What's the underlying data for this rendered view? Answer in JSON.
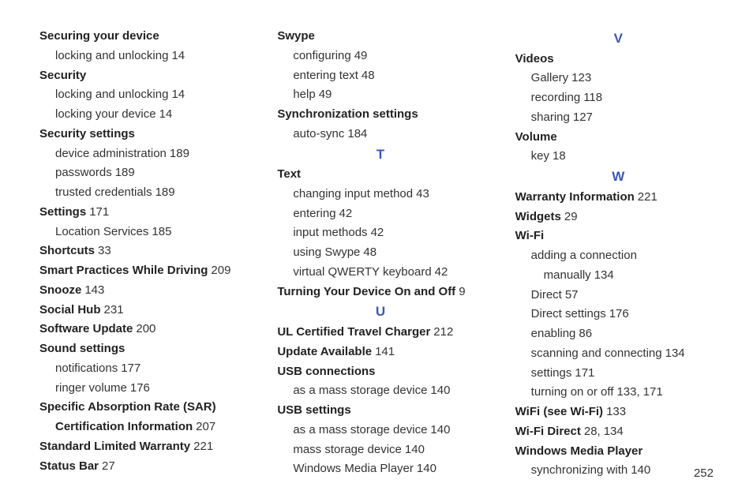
{
  "page_number": "252",
  "col1": {
    "e1_term": "Securing your device",
    "e1_s1": "locking and unlocking",
    "e1_s1_pg": "14",
    "e2_term": "Security",
    "e2_s1": "locking and unlocking",
    "e2_s1_pg": "14",
    "e2_s2": "locking your device",
    "e2_s2_pg": "14",
    "e3_term": "Security settings",
    "e3_s1": "device administration",
    "e3_s1_pg": "189",
    "e3_s2": "passwords",
    "e3_s2_pg": "189",
    "e3_s3": "trusted credentials",
    "e3_s3_pg": "189",
    "e4_term": "Settings",
    "e4_pg": "171",
    "e4_s1": "Location Services",
    "e4_s1_pg": "185",
    "e5_term": "Shortcuts",
    "e5_pg": "33",
    "e6_term": "Smart Practices While Driving",
    "e6_pg": "209",
    "e7_term": "Snooze",
    "e7_pg": "143",
    "e8_term": "Social Hub",
    "e8_pg": "231",
    "e9_term": "Software Update",
    "e9_pg": "200",
    "e10_term": "Sound settings",
    "e10_s1": "notifications",
    "e10_s1_pg": "177",
    "e10_s2": "ringer volume",
    "e10_s2_pg": "176",
    "e11_term": "Specific Absorption Rate (SAR) Certification Information",
    "e11_pg": "207",
    "e12_term": "Standard Limited Warranty",
    "e12_pg": "221",
    "e13_term": "Status Bar",
    "e13_pg": "27"
  },
  "col2": {
    "e1_term": "Swype",
    "e1_s1": "configuring",
    "e1_s1_pg": "49",
    "e1_s2": "entering text",
    "e1_s2_pg": "48",
    "e1_s3": "help",
    "e1_s3_pg": "49",
    "e2_term": "Synchronization settings",
    "e2_s1": "auto-sync",
    "e2_s1_pg": "184",
    "letter_T": "T",
    "e3_term": "Text",
    "e3_s1": "changing input method",
    "e3_s1_pg": "43",
    "e3_s2": "entering",
    "e3_s2_pg": "42",
    "e3_s3": "input methods",
    "e3_s3_pg": "42",
    "e3_s4": "using Swype",
    "e3_s4_pg": "48",
    "e3_s5": "virtual QWERTY keyboard",
    "e3_s5_pg": "42",
    "e4_term": "Turning Your Device On and Off",
    "e4_pg": "9",
    "letter_U": "U",
    "e5_term": "UL Certified Travel Charger",
    "e5_pg": "212",
    "e6_term": "Update Available",
    "e6_pg": "141",
    "e7_term": "USB connections",
    "e7_s1": "as a mass storage device",
    "e7_s1_pg": "140",
    "e8_term": "USB settings",
    "e8_s1": "as a mass storage device",
    "e8_s1_pg": "140",
    "e8_s2": "mass storage device",
    "e8_s2_pg": "140",
    "e8_s3": "Windows Media Player",
    "e8_s3_pg": "140"
  },
  "col3": {
    "letter_V": "V",
    "e1_term": "Videos",
    "e1_s1": "Gallery",
    "e1_s1_pg": "123",
    "e1_s2": "recording",
    "e1_s2_pg": "118",
    "e1_s3": "sharing",
    "e1_s3_pg": "127",
    "e2_term": "Volume",
    "e2_s1": "key",
    "e2_s1_pg": "18",
    "letter_W": "W",
    "e3_term": "Warranty Information",
    "e3_pg": "221",
    "e4_term": "Widgets",
    "e4_pg": "29",
    "e5_term": "Wi-Fi",
    "e5_s1": "adding a connection manually",
    "e5_s1_pg": "134",
    "e5_s2": "Direct",
    "e5_s2_pg": "57",
    "e5_s3": "Direct settings",
    "e5_s3_pg": "176",
    "e5_s4": "enabling",
    "e5_s4_pg": "86",
    "e5_s5": "scanning and connecting",
    "e5_s5_pg": "134",
    "e5_s6": "settings",
    "e5_s6_pg": "171",
    "e5_s7": "turning on or off",
    "e5_s7_pg": "133",
    "e5_s7_pg2": "171",
    "e6_term": "WiFi (see Wi-Fi)",
    "e6_pg": "133",
    "e7_term": "Wi-Fi Direct",
    "e7_pg": "28",
    "e7_pg2": "134",
    "e8_term": "Windows Media Player",
    "e8_s1": "synchronizing with",
    "e8_s1_pg": "140"
  }
}
